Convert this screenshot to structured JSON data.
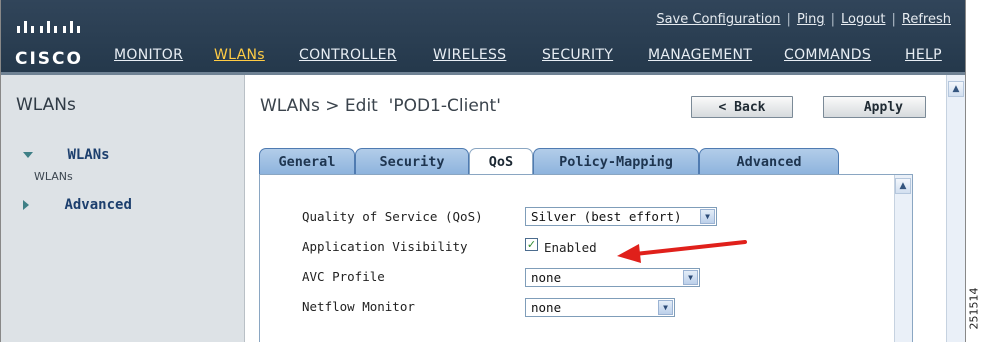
{
  "brand": {
    "logo_text": "CISCO"
  },
  "header": {
    "utility_links": [
      "Save Configuration",
      "Ping",
      "Logout",
      "Refresh"
    ],
    "nav": [
      "MONITOR",
      "WLANs",
      "CONTROLLER",
      "WIRELESS",
      "SECURITY",
      "MANAGEMENT",
      "COMMANDS",
      "HELP"
    ],
    "active_nav": "WLANs"
  },
  "sidebar": {
    "title": "WLANs",
    "items": [
      {
        "label": "WLANs",
        "sub": "WLANs",
        "expanded": true
      },
      {
        "label": "Advanced",
        "expanded": false
      }
    ]
  },
  "page": {
    "title": "WLANs > Edit  'POD1-Client'",
    "back_label": "< Back",
    "apply_label": "Apply"
  },
  "tabs": {
    "items": [
      "General",
      "Security",
      "QoS",
      "Policy-Mapping",
      "Advanced"
    ],
    "active": "QoS"
  },
  "qos_form": {
    "qos_label": "Quality of Service (QoS)",
    "qos_value": "Silver (best effort)",
    "app_visibility_label": "Application Visibility",
    "app_visibility_checked": true,
    "app_visibility_text": "Enabled",
    "avc_profile_label": "AVC Profile",
    "avc_profile_value": "none",
    "netflow_label": "Netflow Monitor",
    "netflow_value": "none"
  },
  "figure_id": "251514",
  "colors": {
    "header": "#24384b",
    "active_nav": "#ffcc44",
    "tab": "#8eb4dd",
    "arrow": "#e0201b"
  },
  "icons": [
    "chevron-down-icon",
    "chevron-up-icon",
    "checkmark-icon",
    "red-arrow-annotation"
  ]
}
